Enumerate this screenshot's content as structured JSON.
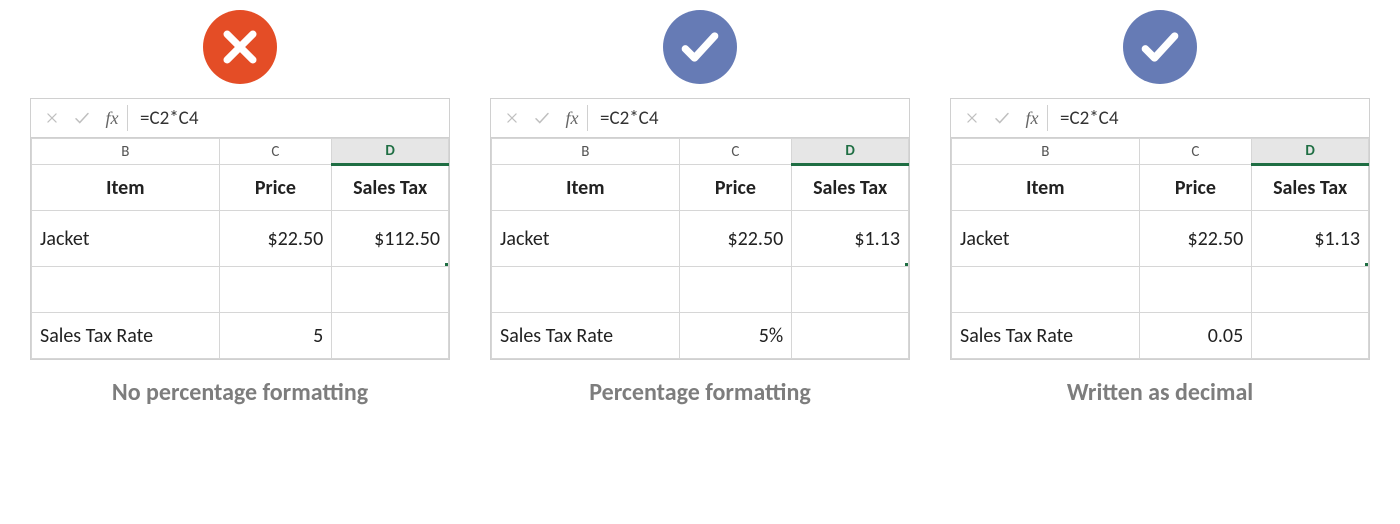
{
  "colors": {
    "badge_x": "#e44d26",
    "badge_ok": "#667bb5",
    "select_green": "#1f6e43"
  },
  "fx_label": "fx",
  "columns": [
    "B",
    "C",
    "D"
  ],
  "headers": {
    "item": "Item",
    "price": "Price",
    "tax": "Sales Tax"
  },
  "row2": {
    "item": "Jacket",
    "price": "$22.50"
  },
  "rateLabel": "Sales Tax Rate",
  "panels": [
    {
      "status": "bad",
      "formula": "=C2*C4",
      "taxResult": "$112.50",
      "rateValue": "5",
      "caption": "No percentage formatting"
    },
    {
      "status": "ok",
      "formula": "=C2*C4",
      "taxResult": "$1.13",
      "rateValue": "5%",
      "caption": "Percentage formatting"
    },
    {
      "status": "ok",
      "formula": "=C2*C4",
      "taxResult": "$1.13",
      "rateValue": "0.05",
      "caption": "Written as decimal"
    }
  ]
}
